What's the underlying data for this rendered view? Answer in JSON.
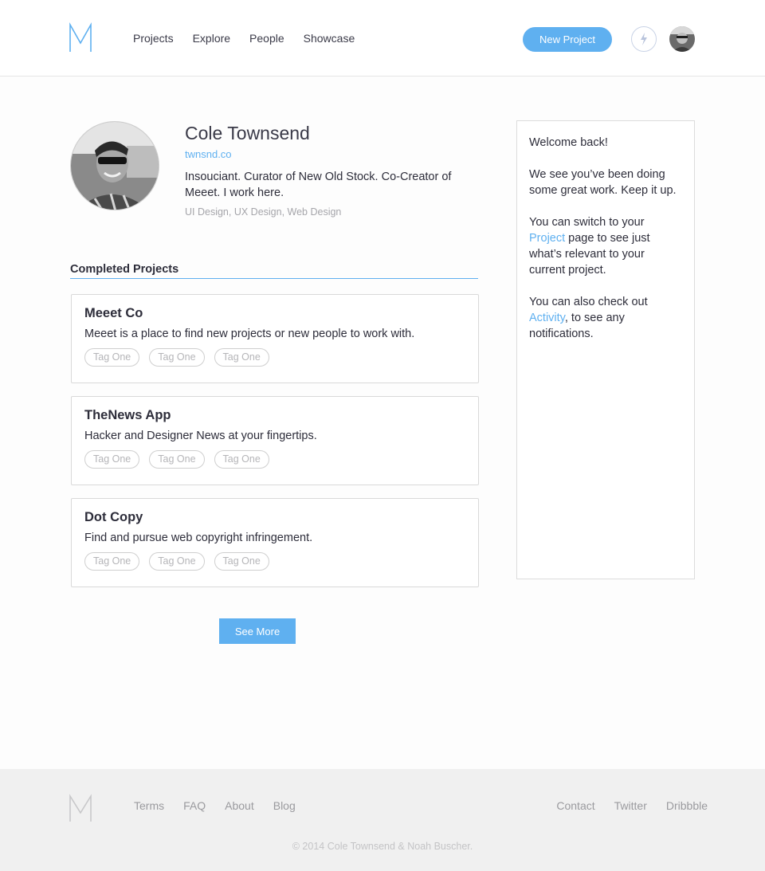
{
  "header": {
    "logo_glyph": "M",
    "nav": [
      "Projects",
      "Explore",
      "People",
      "Showcase"
    ],
    "new_project_label": "New Project",
    "notifications_icon": "bolt-icon",
    "accent_color": "#5fb0f0"
  },
  "profile": {
    "name": "Cole Townsend",
    "site": "twnsnd.co",
    "bio": "Insouciant. Curator of New Old Stock. Co-Creator of Meeet. I work here.",
    "skills": "UI Design, UX Design, Web Design"
  },
  "projects_section": {
    "title": "Completed Projects",
    "items": [
      {
        "title": "Meeet Co",
        "description": "Meeet is a place to find new projects or new people to work with.",
        "tags": [
          "Tag One",
          "Tag One",
          "Tag One"
        ]
      },
      {
        "title": "TheNews App",
        "description": "Hacker and Designer News at your fingertips.",
        "tags": [
          "Tag One",
          "Tag One",
          "Tag One"
        ]
      },
      {
        "title": "Dot Copy",
        "description": "Find and pursue web copyright infringement.",
        "tags": [
          "Tag One",
          "Tag One",
          "Tag One"
        ]
      }
    ],
    "see_more_label": "See More"
  },
  "sidebar": {
    "greeting": "Welcome back!",
    "encouragement": "We see you’ve been doing some great work. Keep it up.",
    "switch_prefix": "You can switch to your",
    "switch_link": "Project",
    "switch_suffix": "page to see just what’s relevant to your current project.",
    "activity_prefix": "You can also check out",
    "activity_link": "Activity",
    "activity_suffix": ", to see any notifications."
  },
  "footer": {
    "logo_glyph": "M",
    "left_links": [
      "Terms",
      "FAQ",
      "About",
      "Blog"
    ],
    "right_links": [
      "Contact",
      "Twitter",
      "Dribbble"
    ],
    "copyright": "© 2014 Cole Townsend & Noah Buscher."
  }
}
